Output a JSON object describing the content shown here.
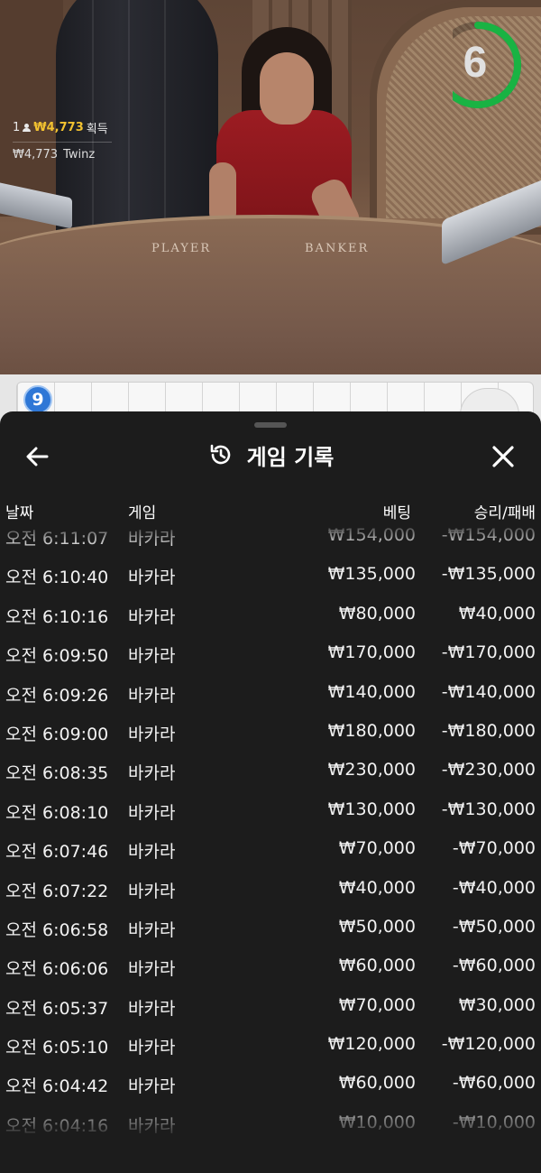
{
  "video": {
    "table_player": "PLAYER",
    "table_banker": "BANKER",
    "win_count": "1",
    "win_amount": "₩4,773",
    "win_suffix": "획득",
    "winner_amount": "₩4,773",
    "winner_name": "Twinz",
    "timer_value": "6",
    "timer_fraction": 0.75,
    "timer_color": "#19b343"
  },
  "road": {
    "round_badge": "9",
    "badge_color": "#2e77d6"
  },
  "history": {
    "title": "게임 기록",
    "back_icon": "arrow-left-icon",
    "title_icon": "history-clock-icon",
    "close_icon": "close-icon",
    "columns": {
      "date": "날짜",
      "game": "게임",
      "bet": "베팅",
      "win_loss": "승리/패배"
    },
    "rows": [
      {
        "date": "오전 6:11:07",
        "game": "바카라",
        "bet": "₩154,000",
        "result": "-₩154,000"
      },
      {
        "date": "오전 6:10:40",
        "game": "바카라",
        "bet": "₩135,000",
        "result": "-₩135,000"
      },
      {
        "date": "오전 6:10:16",
        "game": "바카라",
        "bet": "₩80,000",
        "result": "₩40,000"
      },
      {
        "date": "오전 6:09:50",
        "game": "바카라",
        "bet": "₩170,000",
        "result": "-₩170,000"
      },
      {
        "date": "오전 6:09:26",
        "game": "바카라",
        "bet": "₩140,000",
        "result": "-₩140,000"
      },
      {
        "date": "오전 6:09:00",
        "game": "바카라",
        "bet": "₩180,000",
        "result": "-₩180,000"
      },
      {
        "date": "오전 6:08:35",
        "game": "바카라",
        "bet": "₩230,000",
        "result": "-₩230,000"
      },
      {
        "date": "오전 6:08:10",
        "game": "바카라",
        "bet": "₩130,000",
        "result": "-₩130,000"
      },
      {
        "date": "오전 6:07:46",
        "game": "바카라",
        "bet": "₩70,000",
        "result": "-₩70,000"
      },
      {
        "date": "오전 6:07:22",
        "game": "바카라",
        "bet": "₩40,000",
        "result": "-₩40,000"
      },
      {
        "date": "오전 6:06:58",
        "game": "바카라",
        "bet": "₩50,000",
        "result": "-₩50,000"
      },
      {
        "date": "오전 6:06:06",
        "game": "바카라",
        "bet": "₩60,000",
        "result": "-₩60,000"
      },
      {
        "date": "오전 6:05:37",
        "game": "바카라",
        "bet": "₩70,000",
        "result": "₩30,000"
      },
      {
        "date": "오전 6:05:10",
        "game": "바카라",
        "bet": "₩120,000",
        "result": "-₩120,000"
      },
      {
        "date": "오전 6:04:42",
        "game": "바카라",
        "bet": "₩60,000",
        "result": "-₩60,000"
      },
      {
        "date": "오전 6:04:16",
        "game": "바카라",
        "bet": "₩10,000",
        "result": "-₩10,000"
      }
    ]
  }
}
